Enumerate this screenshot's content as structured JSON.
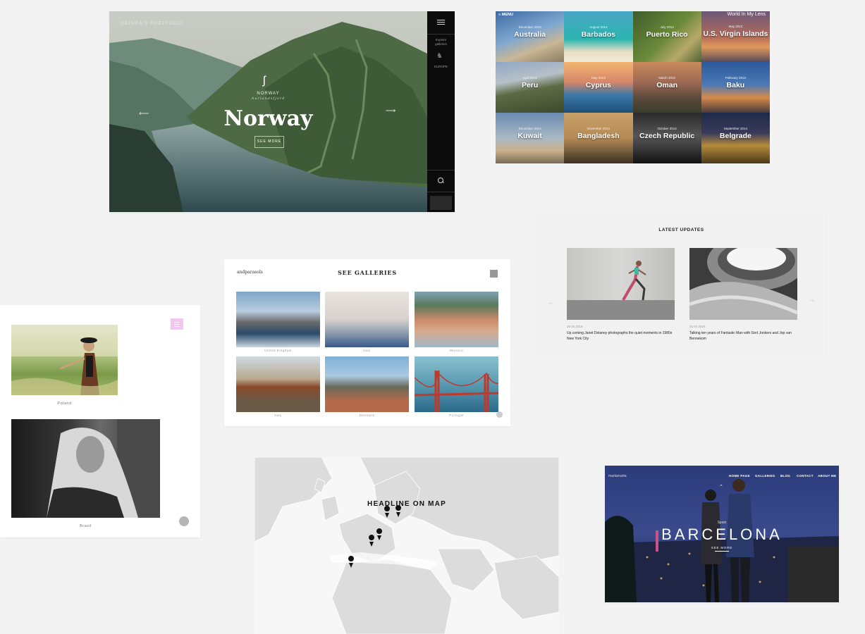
{
  "norway": {
    "brand": "GRISHA'S PORTFOLIO",
    "rail_text": [
      "Explore",
      "galleries"
    ],
    "rail_region": "EUROPE",
    "country_label": "NORWAY",
    "country_sub": "Aurlandsfjord",
    "title": "Norway",
    "see_more": "SEE MORE"
  },
  "grid": {
    "menu_label": "MENU",
    "site_title": "World In My Lens",
    "tiles": [
      {
        "name": "Australia",
        "date": "December 2013"
      },
      {
        "name": "Barbados",
        "date": "August 2013"
      },
      {
        "name": "Puerto Rico",
        "date": "July 2013"
      },
      {
        "name": "U.S. Virgin Islands",
        "date": "May 2013"
      },
      {
        "name": "Peru",
        "date": "April 2013"
      },
      {
        "name": "Cyprus",
        "date": "May 2013"
      },
      {
        "name": "Oman",
        "date": "March 2013"
      },
      {
        "name": "Baku",
        "date": "February 2013"
      },
      {
        "name": "Kuwait",
        "date": "December 2014"
      },
      {
        "name": "Bangladesh",
        "date": "November 2014"
      },
      {
        "name": "Czech Republic",
        "date": "October 2014"
      },
      {
        "name": "Belgrade",
        "date": "September 2014"
      }
    ]
  },
  "latest": {
    "heading": "LATEST UPDATES",
    "posts": [
      {
        "meta": "26    04    2015",
        "title": "Up coming Janet Delaney photographs the quiet moments in 1980s New York City"
      },
      {
        "meta": "26    04    2015",
        "title": "Talking ten years of Fantastic Man with Gert Jonkers and Jop van Bennekom"
      }
    ],
    "prev_arrow": "←",
    "next_arrow": "→"
  },
  "galleries": {
    "brand": "andparasols",
    "heading": "SEE GALLERIES",
    "items": [
      {
        "caption": "United Kingdom"
      },
      {
        "caption": "Italy"
      },
      {
        "caption": "Monaco"
      },
      {
        "caption": "Italy"
      },
      {
        "caption": "Denmark"
      },
      {
        "caption": "Portugal"
      }
    ]
  },
  "portraits": {
    "items": [
      {
        "caption": "Poland"
      },
      {
        "caption": "Brazil"
      }
    ]
  },
  "map": {
    "heading": "HEADLINE ON MAP"
  },
  "barcelona": {
    "brand": "martamarta",
    "nav": [
      "HOME PAGE",
      "GALLERIES",
      "BLOG",
      "CONTACT",
      "ABOUT ME"
    ],
    "subtitle": "Spain",
    "title": "BARCELONA",
    "see_more": "SEE MORE"
  },
  "colors": {
    "page_bg": "#f4f3f3",
    "dark_rail": "#0b0b0b",
    "menu_pink": "#f2c6ee"
  }
}
